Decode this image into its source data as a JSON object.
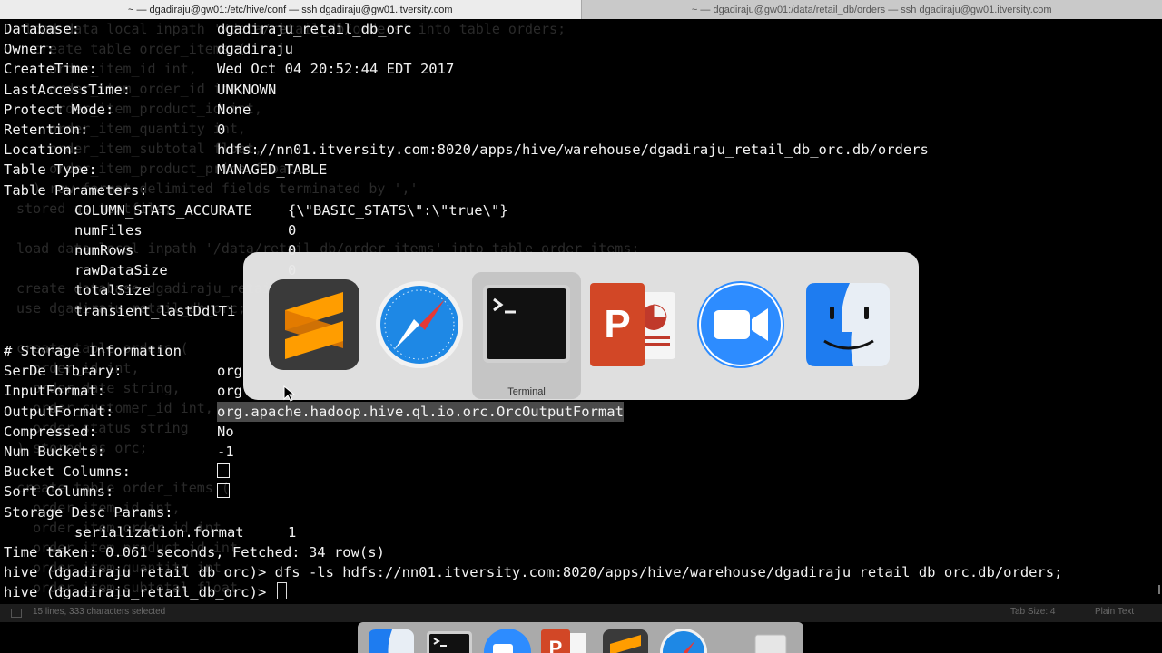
{
  "tabs": [
    {
      "label": "~ — dgadiraju@gw01:/etc/hive/conf — ssh dgadiraju@gw01.itversity.com",
      "active": true
    },
    {
      "label": "~ — dgadiraju@gw01:/data/retail_db/orders — ssh dgadiraju@gw01.itversity.com",
      "active": false
    }
  ],
  "terminal": {
    "rows": [
      {
        "key": "Database:",
        "value": "dgadiraju_retail_db_orc"
      },
      {
        "key": "Owner:",
        "value": "dgadiraju"
      },
      {
        "key": "CreateTime:",
        "value": "Wed Oct 04 20:52:44 EDT 2017"
      },
      {
        "key": "LastAccessTime:",
        "value": "UNKNOWN"
      },
      {
        "key": "Protect Mode:",
        "value": "None"
      },
      {
        "key": "Retention:",
        "value": "0"
      },
      {
        "key": "Location:",
        "value": "hdfs://nn01.itversity.com:8020/apps/hive/warehouse/dgadiraju_retail_db_orc.db/orders"
      },
      {
        "key": "Table Type:",
        "value": "MANAGED_TABLE"
      },
      {
        "key": "Table Parameters:",
        "value": ""
      }
    ],
    "table_params": [
      {
        "key": "COLUMN_STATS_ACCURATE",
        "value": "{\\\"BASIC_STATS\\\":\\\"true\\\"}"
      },
      {
        "key": "numFiles",
        "value": "0"
      },
      {
        "key": "numRows",
        "value": "0"
      },
      {
        "key": "rawDataSize",
        "value": "0"
      },
      {
        "key": "totalSize",
        "value": "0"
      },
      {
        "key": "transient_lastDdlTi",
        "value": ""
      }
    ],
    "storage_header": "# Storage Information",
    "storage_rows": [
      {
        "key": "SerDe Library:",
        "value": "org"
      },
      {
        "key": "InputFormat:",
        "value": "org"
      },
      {
        "key": "OutputFormat:",
        "value": "org.apache.hadoop.hive.ql.io.orc.OrcOutputFormat"
      },
      {
        "key": "Compressed:",
        "value": "No"
      },
      {
        "key": "Num Buckets:",
        "value": "-1"
      }
    ],
    "bucket_columns_label": "Bucket Columns:",
    "sort_columns_label": "Sort Columns:",
    "storage_desc_label": "Storage Desc Params:",
    "serialization": {
      "key": "serialization.format",
      "value": "1"
    },
    "time_taken": "Time taken: 0.061 seconds, Fetched: 34 row(s)",
    "command_line": "hive (dgadiraju_retail_db_orc)> dfs -ls hdfs://nn01.itversity.com:8020/apps/hive/warehouse/dgadiraju_retail_db_orc.db/orders;",
    "prompt": "hive (dgadiraju_retail_db_orc)> "
  },
  "ghost_text": [
    "   load data local inpath '/data/retail_db/orders' into table orders;",
    "    create table order_items (",
    "      order_item_id int,",
    "      order_item_order_id int,",
    "      order_item_product_id int,",
    "      order_item_quantity int,",
    "      order_item_subtotal float,",
    "      order_item_product_price float",
    "    ) row format delimited fields terminated by ','",
    "  stored as textfile;",
    "",
    "  load data local inpath '/data/retail_db/order_items' into table order_items;",
    "",
    "  create database dgadiraju_retail_db_orc;",
    "  use dgadiraju_retail_db_orc;",
    "",
    "  create table orders (",
    "    order_id int,",
    "    order_date string,",
    "    order_customer_id int,",
    "    order_status string",
    "  ) stored as orc;",
    "",
    "  create table order_items (",
    "    order_item_id int,",
    "    order_item_order_id int,",
    "    order_item_product_id int,",
    "    order_item_quantity int,",
    "    order_item_subtotal float,"
  ],
  "switcher": {
    "apps": [
      "sublime-text",
      "safari",
      "terminal",
      "powerpoint",
      "zoom",
      "finder"
    ],
    "selected_label": "Terminal"
  },
  "statusbar": {
    "left": "15 lines, 333 characters selected",
    "tab_size": "Tab Size: 4",
    "syntax": "Plain Text"
  },
  "dock": {
    "apps": [
      "finder",
      "terminal",
      "zoom",
      "powerpoint",
      "sublime-text",
      "safari",
      "trash"
    ]
  },
  "colors": {
    "terminal_bg": "#000000",
    "terminal_fg": "#f2f2f2",
    "selection": "#4a4a4a",
    "sublime": "#ff9800",
    "safari": "#1e88e5",
    "powerpoint": "#d24726",
    "zoom": "#2d8cff",
    "finder": "#1e7cf0"
  }
}
